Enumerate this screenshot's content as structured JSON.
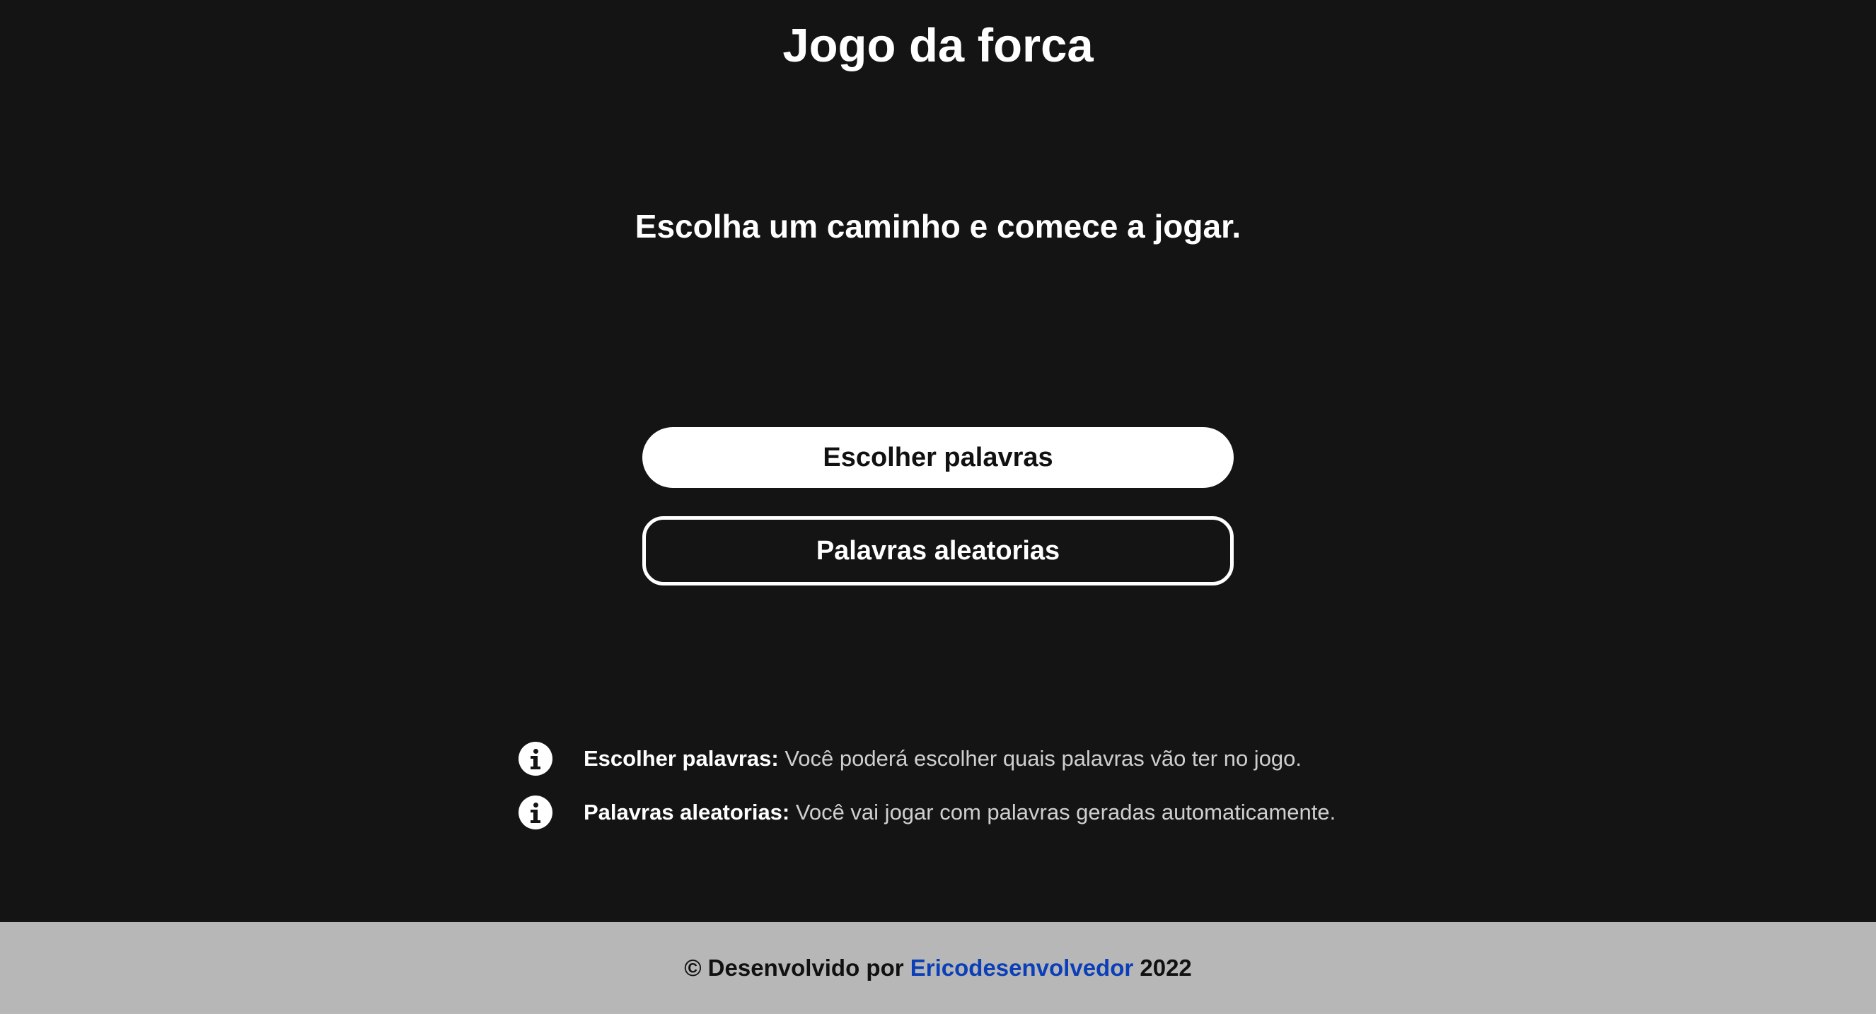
{
  "page": {
    "title": "Jogo da forca",
    "subtitle": "Escolha um caminho e comece a jogar."
  },
  "actions": {
    "choose_words_label": "Escolher palavras",
    "random_words_label": "Palavras aleatorias"
  },
  "info": [
    {
      "icon": "info-icon",
      "term": "Escolher palavras:",
      "description": "Você poderá escolher quais palavras vão ter no jogo."
    },
    {
      "icon": "info-icon",
      "term": "Palavras aleatorias:",
      "description": "Você vai jogar com palavras geradas automaticamente."
    }
  ],
  "footer": {
    "prefix": "© Desenvolvido por",
    "author": "Ericodesenvolvedor",
    "year": "2022"
  },
  "colors": {
    "background": "#141414",
    "footer_background": "#b7b7b7",
    "link": "#0b3fb8",
    "button_primary": "#ffffff"
  }
}
